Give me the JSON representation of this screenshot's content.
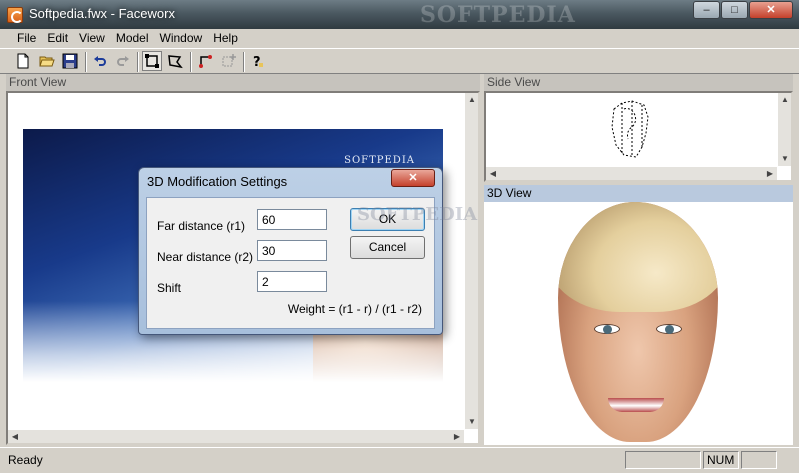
{
  "window": {
    "title": "Softpedia.fwx - Faceworx",
    "watermark": "SOFTPEDIA",
    "minimize": "‒",
    "maximize": "□",
    "close": "✕"
  },
  "menu": [
    "File",
    "Edit",
    "View",
    "Model",
    "Window",
    "Help"
  ],
  "toolbar": {
    "icons": [
      "new-file-icon",
      "open-folder-icon",
      "save-icon",
      "undo-icon",
      "redo-icon",
      "select-rect-icon",
      "select-poly-icon",
      "connect-points-icon",
      "add-point-icon",
      "help-icon"
    ]
  },
  "panels": {
    "front": {
      "title": "Front View",
      "brand": "SOFTPEDIA"
    },
    "side": {
      "title": "Side View"
    },
    "view3d": {
      "title": "3D View"
    }
  },
  "dialog": {
    "title": "3D Modification Settings",
    "close_label": "✕",
    "watermark": "SOFTPEDIA",
    "fields": [
      {
        "label": "Far distance (r1)",
        "value": "60"
      },
      {
        "label": "Near distance (r2)",
        "value": "30"
      },
      {
        "label": "Shift",
        "value": "2"
      }
    ],
    "ok_label": "OK",
    "cancel_label": "Cancel",
    "formula": "Weight = (r1 - r) / (r1 - r2)"
  },
  "status": {
    "text": "Ready",
    "num": "NUM"
  },
  "colors": {
    "active_header": "#b9c9de",
    "inactive_header": "#c6c3bd"
  }
}
